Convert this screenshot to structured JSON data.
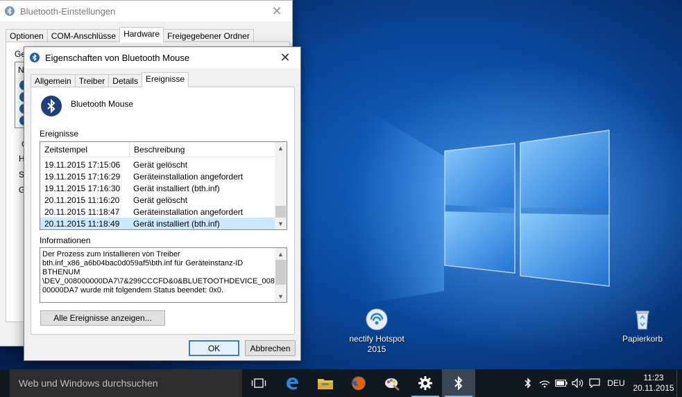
{
  "desktop": {
    "icons": [
      {
        "label": "nectify Hotspot 2015",
        "icon": "connectify-hotspot-icon"
      },
      {
        "label": "Papierkorb",
        "icon": "recycle-bin-icon"
      }
    ]
  },
  "bg_window": {
    "title": "Bluetooth-Einstellungen",
    "tabs": [
      "Optionen",
      "COM-Anschlüsse",
      "Hardware",
      "Freigegebener Ordner"
    ],
    "active_tab": "Hardware",
    "visible_fragments": [
      "Ge",
      "N",
      "G",
      "H",
      "S",
      "G"
    ]
  },
  "dialog": {
    "title": "Eigenschaften von Bluetooth Mouse",
    "tabs": [
      "Allgemein",
      "Treiber",
      "Details",
      "Ereignisse"
    ],
    "active_tab": "Ereignisse",
    "device_name": "Bluetooth Mouse",
    "events_label": "Ereignisse",
    "columns": [
      "Zeitstempel",
      "Beschreibung"
    ],
    "events": [
      {
        "time": "19.11.2015 17:15:06",
        "desc": "Gerät gelöscht"
      },
      {
        "time": "19.11.2015 17:16:29",
        "desc": "Geräteinstallation angefordert"
      },
      {
        "time": "19.11.2015 17:16:30",
        "desc": "Gerät installiert (bth.inf)"
      },
      {
        "time": "20.11.2015 11:16:20",
        "desc": "Gerät gelöscht"
      },
      {
        "time": "20.11.2015 11:18:47",
        "desc": "Geräteinstallation angefordert"
      },
      {
        "time": "20.11.2015 11:18:49",
        "desc": "Gerät installiert (bth.inf)"
      }
    ],
    "selected_event_index": 5,
    "info_label": "Informationen",
    "info_lines": [
      "Der Prozess zum Installieren von Treiber",
      "bth.inf_x86_a6b04bac0d059af5\\bth.inf für Geräteinstanz-ID",
      "BTHENUM",
      "\\DEV_008000000DA7\\7&299CCCFD&0&BLUETOOTHDEVICE_0080",
      "00000DA7 wurde mit folgendem Status beendet: 0x0."
    ],
    "show_all_button": "Alle Ereignisse anzeigen...",
    "ok_button": "OK",
    "cancel_button": "Abbrechen"
  },
  "taskbar": {
    "search_placeholder": "Web und Windows durchsuchen",
    "apps": [
      "task-view-icon",
      "edge-icon",
      "file-explorer-icon",
      "firefox-icon",
      "paint-icon",
      "settings-icon",
      "bluetooth-icon"
    ],
    "tray": [
      "bluetooth-icon",
      "wifi-icon",
      "battery-icon",
      "volume-icon",
      "notification-icon"
    ],
    "language": "DEU",
    "time": "11:23",
    "date": "20.11.2015"
  },
  "colors": {
    "accent": "#3c7fb1",
    "selection": "#cce8ff",
    "taskbar": "#101820",
    "bluetooth": "#1f5fa8"
  }
}
